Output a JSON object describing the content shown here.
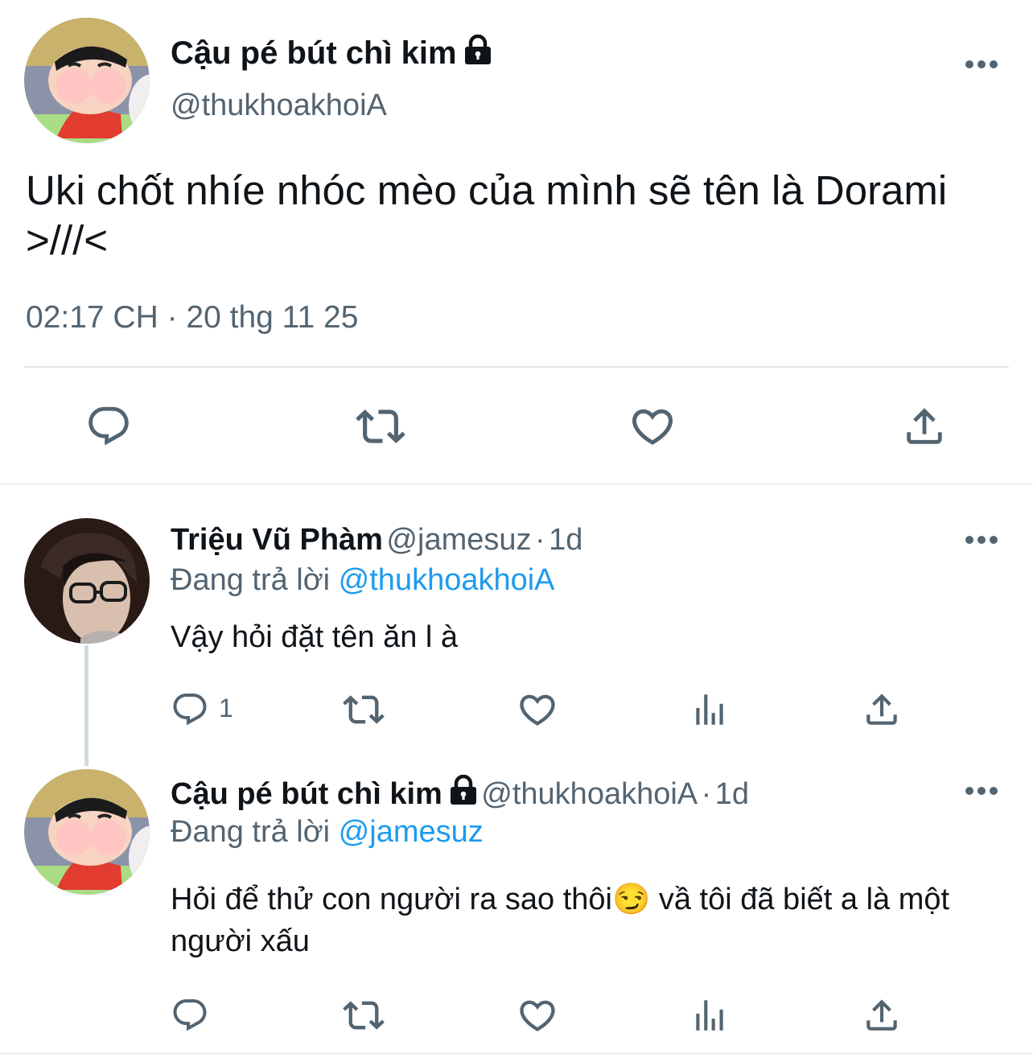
{
  "main_tweet": {
    "display_name": "Cậu pé bút chì kim",
    "handle": "@thukhoakhoiA",
    "text": "Uki chốt nhíe nhóc mèo của mình sẽ tên là Dorami >///<",
    "timestamp": "02:17 CH · 20 thg 11 25",
    "protected": true,
    "more_label": "•••",
    "actions": [
      "reply-icon",
      "retweet-icon",
      "like-icon",
      "share-icon"
    ]
  },
  "replies": [
    {
      "display_name": "Triệu Vũ Phàm",
      "handle": "@jamesuz",
      "separator": "·",
      "age": "1d",
      "replying_prefix": "Đang trả lời",
      "replying_to": "@thukhoakhoiA",
      "text": "Vậy hỏi đặt tên ăn l à",
      "reply_count": "1",
      "more_label": "•••"
    },
    {
      "display_name": "Cậu pé bút chì kim",
      "protected": true,
      "handle": "@thukhoakhoiA",
      "separator": "·",
      "age": "1d",
      "replying_prefix": "Đang trả lời",
      "replying_to": "@jamesuz",
      "text": "Hỏi để thử con người ra sao thôi😏 vầ tôi đã biết a là một người xấu",
      "reply_count": "",
      "more_label": "•••"
    }
  ],
  "colors": {
    "text_primary": "#0f1419",
    "text_secondary": "#536471",
    "link": "#1d9bf0",
    "divider": "#e1e8ed"
  }
}
